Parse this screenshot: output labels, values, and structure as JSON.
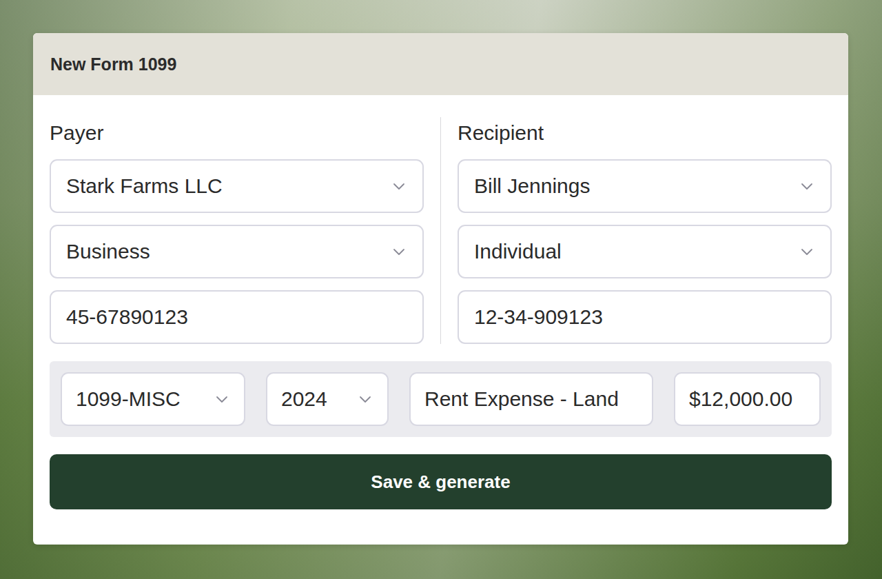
{
  "form": {
    "title": "New Form 1099"
  },
  "parties": [
    {
      "heading": "Payer",
      "fields": [
        {
          "value": "Stark Farms LLC",
          "kind": "select"
        },
        {
          "value": "Business",
          "kind": "select"
        },
        {
          "value": "45-67890123",
          "kind": "text"
        }
      ]
    },
    {
      "heading": "Recipient",
      "fields": [
        {
          "value": "Bill Jennings",
          "kind": "select"
        },
        {
          "value": "Individual",
          "kind": "select"
        },
        {
          "value": "12-34-909123",
          "kind": "text"
        }
      ]
    }
  ],
  "details": [
    {
      "value": "1099-MISC",
      "kind": "select"
    },
    {
      "value": "2024",
      "kind": "select"
    },
    {
      "value": "Rent Expense - Land",
      "kind": "text"
    },
    {
      "value": "$12,000.00",
      "kind": "text"
    }
  ],
  "buttons": [
    "Save & generate"
  ]
}
